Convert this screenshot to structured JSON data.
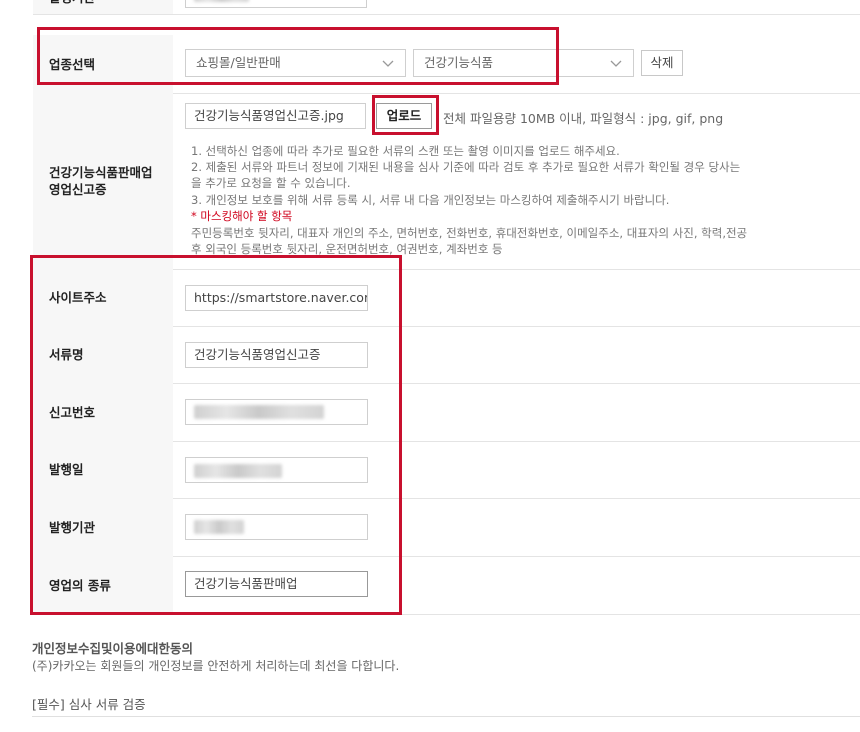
{
  "top_row": {
    "label": "발행기관"
  },
  "business_type": {
    "label": "업종선택",
    "select1": "쇼핑몰/일반판매",
    "select2": "건강기능식품",
    "delete_label": "삭제"
  },
  "upload": {
    "label": "건강기능식품판매업 영업신고증",
    "file_name": "건강기능식품영업신고증.jpg",
    "upload_label": "업로드",
    "file_hint": "전체 파일용량 10MB 이내, 파일형식 : jpg, gif, png",
    "notes": [
      "1. 선택하신 업종에 따라 추가로 필요한 서류의 스캔 또는 촬영 이미지를 업로드 해주세요.",
      "2. 제출된 서류와 파트너 정보에 기재된 내용을 심사 기준에 따라 검토 후 추가로 필요한 서류가 확인될 경우 당사는",
      "을 추가로 요청을 할 수 있습니다.",
      "3. 개인정보 보호를 위해 서류 등록 시, 서류 내 다음 개인정보는 마스킹하여 제출해주시기 바랍니다."
    ],
    "mask_title": "* 마스킹해야 할 항목",
    "mask_items": [
      "주민등록번호 뒷자리, 대표자 개인의 주소, 면허번호, 전화번호, 휴대전화번호, 이메일주소, 대표자의 사진, 학력,전공",
      "후 외국인 등록번호 뒷자리, 운전면허번호, 여권번호, 계좌번호 등"
    ]
  },
  "fields": {
    "site": {
      "label": "사이트주소",
      "value": "https://smartstore.naver.com/"
    },
    "doc_name": {
      "label": "서류명",
      "value": "건강기능식품영업신고증"
    },
    "report_no": {
      "label": "신고번호"
    },
    "issue_date": {
      "label": "발행일"
    },
    "issuer": {
      "label": "발행기관"
    },
    "business_kind": {
      "label": "영업의 종류",
      "value": "건강기능식품판매업"
    }
  },
  "consent": {
    "title": "개인정보수집및이용에대한동의",
    "text": "(주)카카오는 회원들의 개인정보를 안전하게 처리하는데 최선을 다합니다.",
    "check_label": "[필수] 심사 서류 검증"
  },
  "colors": {
    "highlight": "#c8102e",
    "label_bg": "#f7f7f7",
    "required": "#d0021b"
  }
}
